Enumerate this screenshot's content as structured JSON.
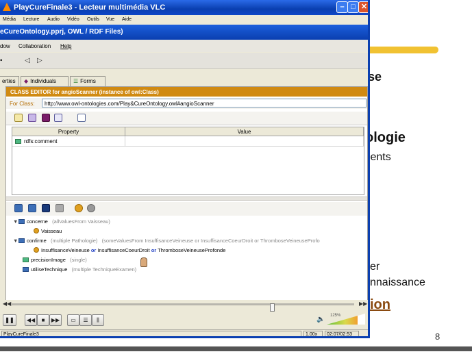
{
  "slide": {
    "texts": {
      "se": "se",
      "ologie": "ologie",
      "alents": "alents",
      "er": "er",
      "nnaissance": "nnaissance",
      "ion": "ion"
    },
    "page_number": "8",
    "accent_color": "#f1c232",
    "link_color": "#8a4a10"
  },
  "vlc": {
    "title": "PlayCureFinale3 - Lecteur multimédia VLC",
    "menu": [
      "Média",
      "Lecture",
      "Audio",
      "Vidéo",
      "Outils",
      "Vue",
      "Aide"
    ],
    "status_name": "PlayCureFinale3",
    "speed": "1.00x",
    "time": "02:07/02:53",
    "volume_label": "125%",
    "volume_level": 0.8,
    "seek_position": 0.76
  },
  "protege": {
    "project_title": "eCureOntology.pprj, OWL / RDF Files)",
    "menu": [
      "dow",
      "Collaboration",
      "Help"
    ],
    "tabs": [
      "erties",
      "Individuals",
      "Forms"
    ],
    "editor_header": "CLASS EDITOR for angioScanner   (instance of owl:Class)",
    "for_class_label": "For Class:",
    "for_class_url": "http://www.owl-ontologies.com/Play&CureOntology.owl#angioScanner",
    "grid_headers": [
      "Property",
      "Value"
    ],
    "grid_rows": [
      {
        "property": "rdfs:comment",
        "value": ""
      }
    ],
    "tree": {
      "concerne": {
        "name": "concerne",
        "note": "(allValuesFrom Vaisseau)",
        "child": "Vaisseau"
      },
      "confirme": {
        "name": "confirme",
        "note": "(multiple Pathologie)",
        "note2": "(someValuesFrom InsuffisanceVeineuse or InsuffisanceCoeurDroit or ThromboseVeineuseProfo",
        "child_a": "InsuffisanceVeineuse",
        "child_or1": "or",
        "child_b": "InsuffisanceCoeurDroit",
        "child_or2": "or",
        "child_c": "ThromboseVeineuseProfonde"
      },
      "precisionImage": {
        "name": "precisionImage",
        "note": "(single)"
      },
      "utiliseTechnique": {
        "name": "utiliseTechnique",
        "note": "(multiple TechniqueExamen)"
      }
    }
  }
}
